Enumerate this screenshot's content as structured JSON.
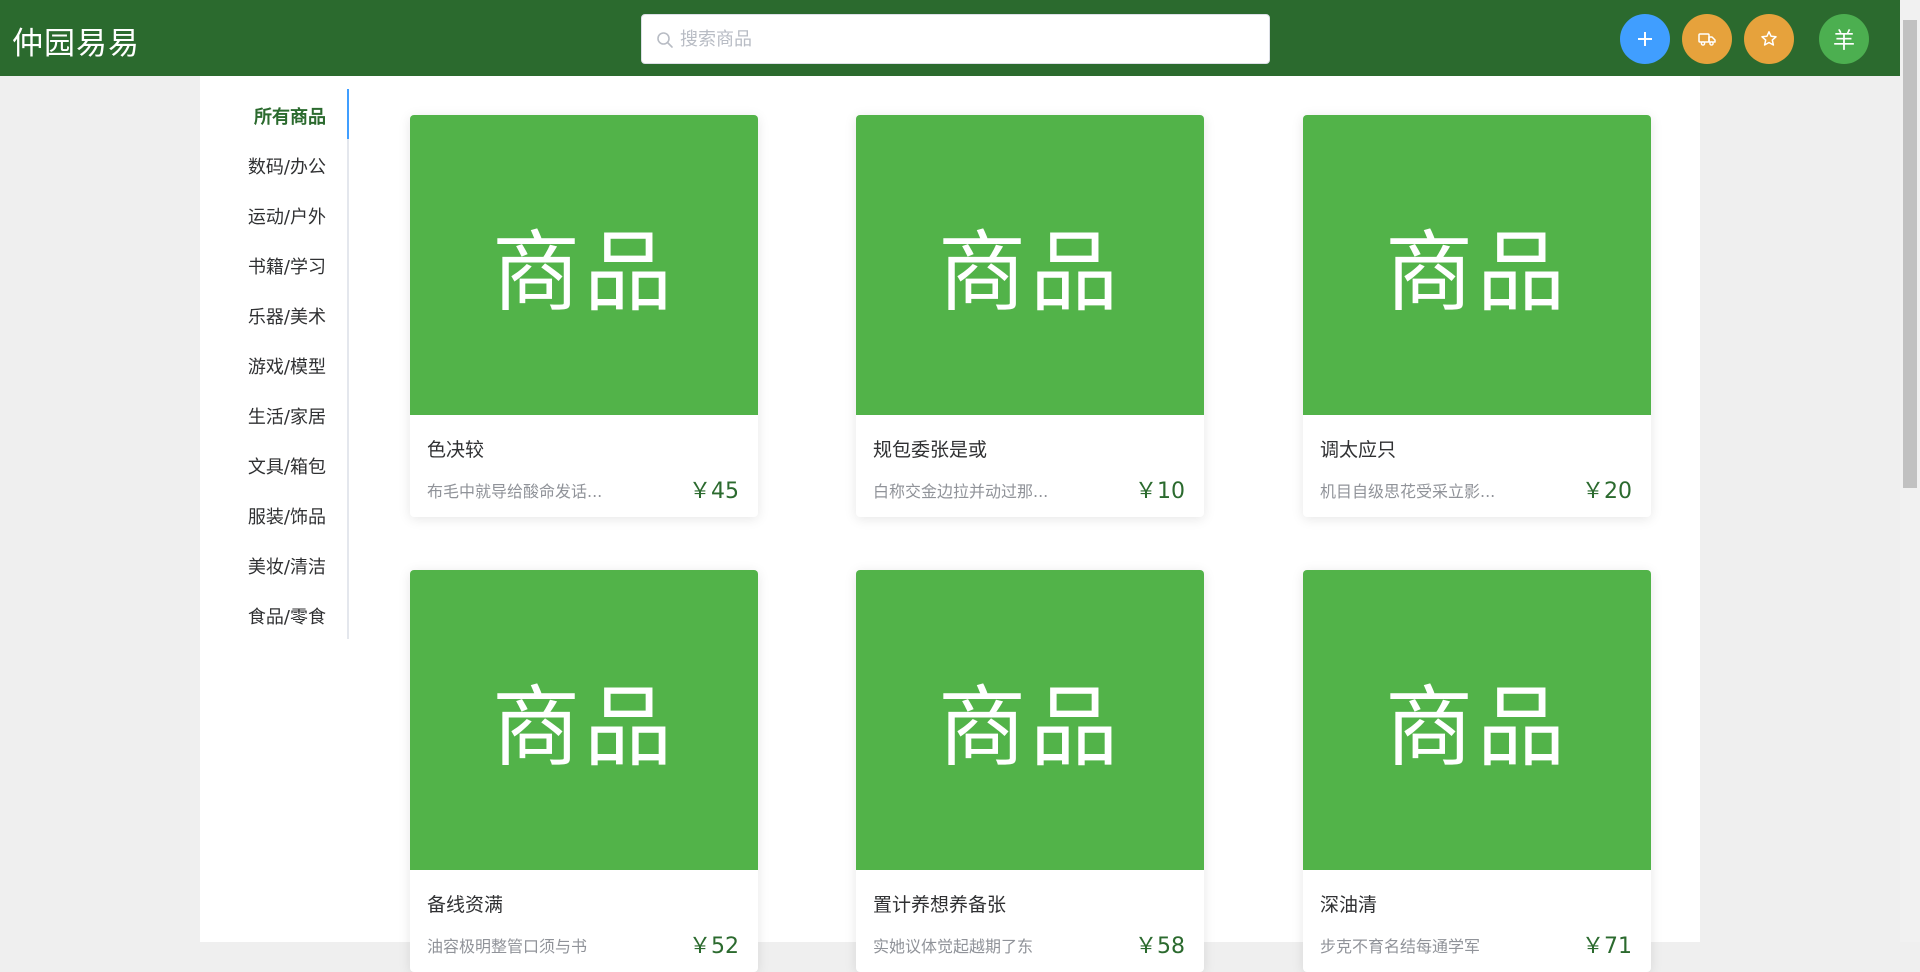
{
  "header": {
    "brand": "仲园易易",
    "search_placeholder": "搜索商品",
    "avatar_text": "羊",
    "bg_color": "#2b6a2e",
    "add_button_color": "#409eff",
    "action_button_color": "#e6a23c"
  },
  "sidebar": {
    "items": [
      {
        "label": "所有商品",
        "active": true
      },
      {
        "label": "数码/办公"
      },
      {
        "label": "运动/户外"
      },
      {
        "label": "书籍/学习"
      },
      {
        "label": "乐器/美术"
      },
      {
        "label": "游戏/模型"
      },
      {
        "label": "生活/家居"
      },
      {
        "label": "文具/箱包"
      },
      {
        "label": "服装/饰品"
      },
      {
        "label": "美妆/清洁"
      },
      {
        "label": "食品/零食"
      }
    ]
  },
  "products": [
    {
      "image_text": "商品",
      "title": "色决较",
      "desc": "布毛中就导给酸命发话...",
      "price": "￥45"
    },
    {
      "image_text": "商品",
      "title": "规包委张是或",
      "desc": "白称交金边拉并动过那...",
      "price": "￥10"
    },
    {
      "image_text": "商品",
      "title": "调太应只",
      "desc": "机目自级思花受采立影...",
      "price": "￥20"
    },
    {
      "image_text": "商品",
      "title": "备线资满",
      "desc": "油容极明整管口须与书",
      "price": "￥52"
    },
    {
      "image_text": "商品",
      "title": "置计养想养备张",
      "desc": "实她议体觉起越期了东",
      "price": "￥58"
    },
    {
      "image_text": "商品",
      "title": "深油清",
      "desc": "步克不育名结每通学军",
      "price": "￥71"
    }
  ],
  "colors": {
    "card_image_bg": "#52b349",
    "price": "#2b6a2e",
    "active_indicator": "#409eff"
  }
}
